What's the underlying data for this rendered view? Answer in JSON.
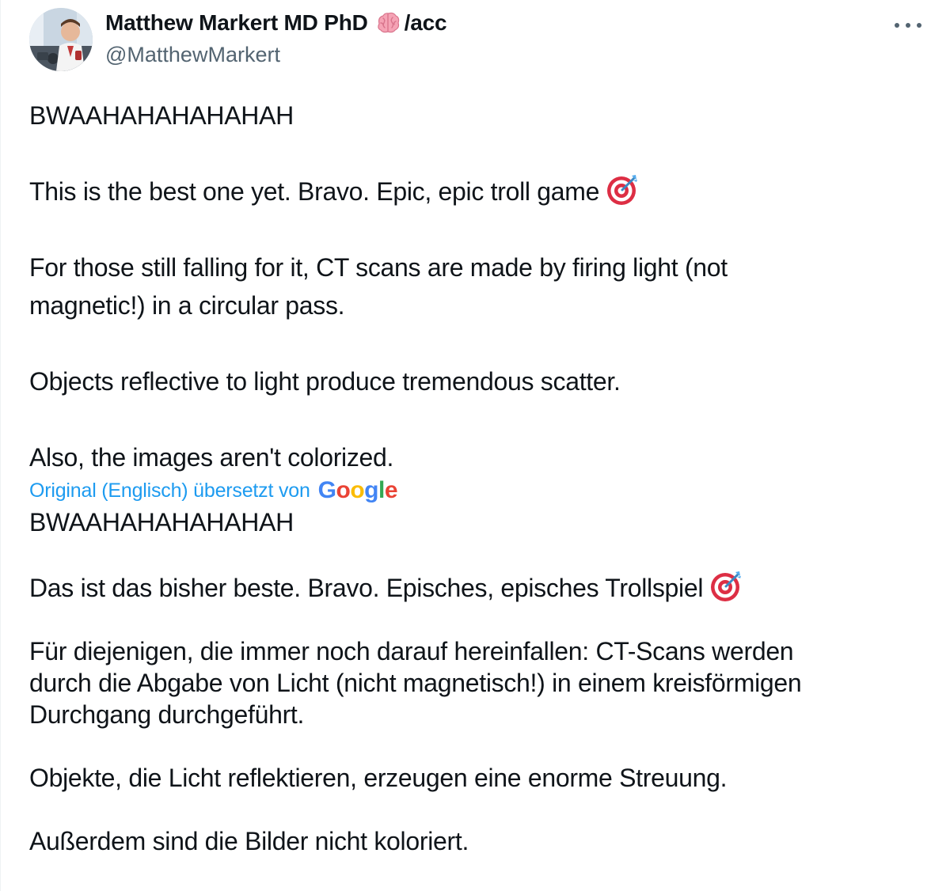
{
  "author": {
    "name": "Matthew Markert MD PhD",
    "name_suffix": "/acc",
    "handle": "@MatthewMarkert",
    "badge_icon": "brain-emoji-icon"
  },
  "menu": {
    "icon": "more-horizontal-icon"
  },
  "original": {
    "line1": "BWAAHAHAHAHAHAH",
    "line2": "This is the best one yet. Bravo. Epic, epic troll game",
    "line2_icon": "direct-hit-emoji-icon",
    "line3a": "For those still falling for it, CT scans are made by firing light (not",
    "line3b": "magnetic!) in a circular pass.",
    "line4": "Objects reflective to light produce tremendous scatter.",
    "line5": "Also, the images aren't colorized."
  },
  "translation": {
    "label": "Original (Englisch) übersetzt von",
    "provider_letters": [
      "G",
      "o",
      "o",
      "g",
      "l",
      "e"
    ],
    "provider_colors": [
      "#4285F4",
      "#EA4335",
      "#FBBC05",
      "#4285F4",
      "#34A853",
      "#EA4335"
    ],
    "line1": "BWAAHAHAHAHAHAH",
    "line2": "Das ist das bisher beste. Bravo. Episches, episches Trollspiel",
    "line2_icon": "direct-hit-emoji-icon",
    "line3a": "Für diejenigen, die immer noch darauf hereinfallen: CT-Scans werden",
    "line3b": "durch die Abgabe von Licht (nicht magnetisch!) in einem kreisförmigen",
    "line3c": "Durchgang durchgeführt.",
    "line4": "Objekte, die Licht reflektieren, erzeugen eine enorme Streuung.",
    "line5": "Außerdem sind die Bilder nicht koloriert."
  },
  "colors": {
    "text": "#0f1419",
    "secondary": "#536471",
    "link": "#1d9bf0"
  }
}
